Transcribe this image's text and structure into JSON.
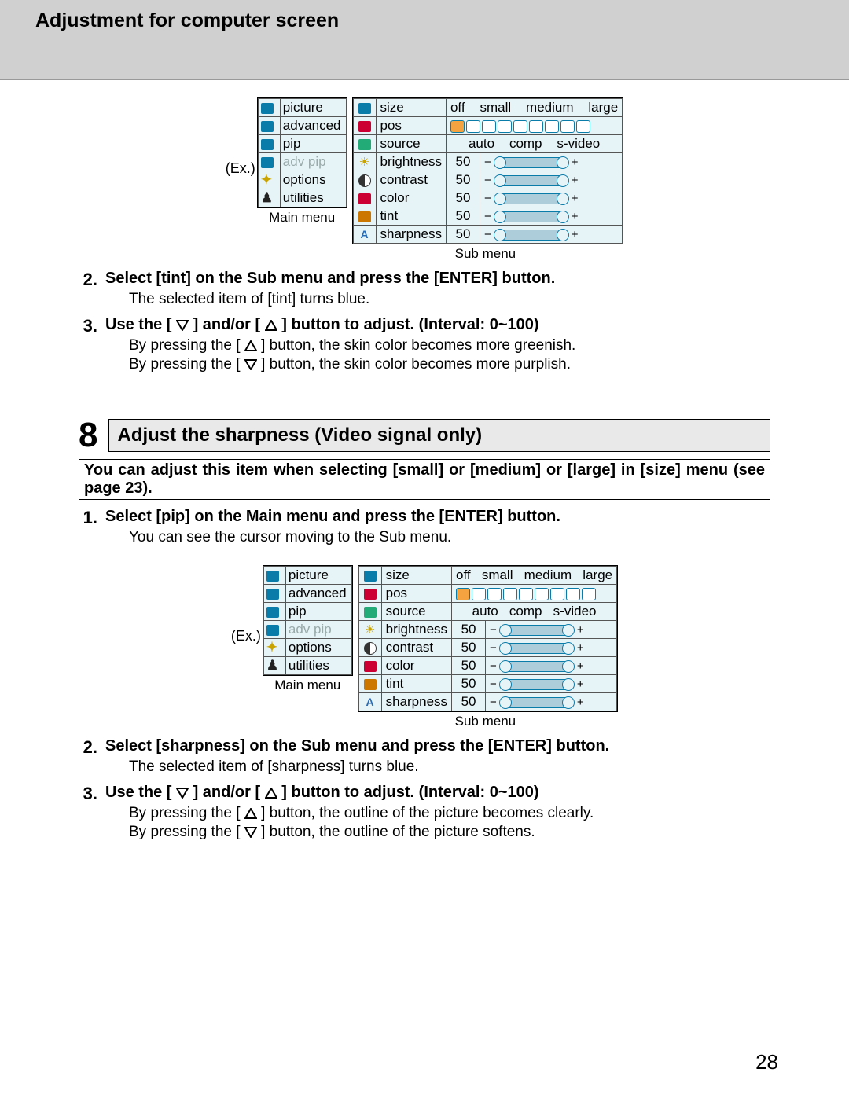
{
  "header": {
    "title": "Adjustment for computer screen"
  },
  "ex_label": "(Ex.)",
  "main_menu": {
    "caption": "Main menu",
    "items": [
      {
        "label": "picture",
        "disabled": false
      },
      {
        "label": "advanced",
        "disabled": false
      },
      {
        "label": "pip",
        "disabled": false
      },
      {
        "label": "adv pip",
        "disabled": true
      },
      {
        "label": "options",
        "disabled": false
      },
      {
        "label": "utilities",
        "disabled": false
      }
    ]
  },
  "sub_menu": {
    "caption": "Sub menu",
    "size": {
      "label": "size",
      "options": [
        "off",
        "small",
        "medium",
        "large"
      ]
    },
    "pos": {
      "label": "pos",
      "boxes": 9,
      "selected": 1
    },
    "source": {
      "label": "source",
      "options": [
        "auto",
        "comp",
        "s-video"
      ]
    },
    "sliders": [
      {
        "label": "brightness",
        "value": 50
      },
      {
        "label": "contrast",
        "value": 50
      },
      {
        "label": "color",
        "value": 50
      },
      {
        "label": "tint",
        "value": 50
      },
      {
        "label": "sharpness",
        "value": 50
      }
    ]
  },
  "steps_a": {
    "s2": {
      "num": "2.",
      "title_parts": [
        "Select [",
        "tint",
        "] on the Sub menu and press the [",
        "ENTER",
        "] button."
      ],
      "sub": "The selected item of [tint] turns blue."
    },
    "s3": {
      "num": "3.",
      "title_pre": "Use the [ ",
      "title_mid": " ] and/or [ ",
      "title_post": " ] button to adjust. (Interval: 0~100)",
      "sub1_pre": "By pressing the [ ",
      "sub1_post": " ] button, the skin color becomes more greenish.",
      "sub2_pre": "By pressing the [ ",
      "sub2_post": " ] button, the skin color becomes more purplish."
    }
  },
  "section8": {
    "num": "8",
    "title": "Adjust the sharpness (Video signal only)",
    "note": "You can adjust this item when selecting [small] or [medium] or [large] in [size] menu (see page 23)."
  },
  "steps_b": {
    "s1": {
      "num": "1.",
      "title_parts": [
        "Select [",
        "pip",
        "] on the Main menu and press the [",
        "ENTER",
        "] button."
      ],
      "sub": "You can see the cursor moving to the Sub menu."
    },
    "s2": {
      "num": "2.",
      "title_parts": [
        "Select [",
        "sharpness",
        "] on the Sub menu and press the [",
        "ENTER",
        "] button."
      ],
      "sub": "The selected item of [sharpness] turns blue."
    },
    "s3": {
      "num": "3.",
      "title_pre": "Use the [ ",
      "title_mid": " ] and/or [ ",
      "title_post": " ] button to adjust. (Interval: 0~100)",
      "sub1_pre": "By pressing the [ ",
      "sub1_post": " ] button, the outline of the picture becomes clearly.",
      "sub2_pre": "By pressing the [ ",
      "sub2_post": " ] button, the outline of the picture softens."
    }
  },
  "page_number": "28"
}
